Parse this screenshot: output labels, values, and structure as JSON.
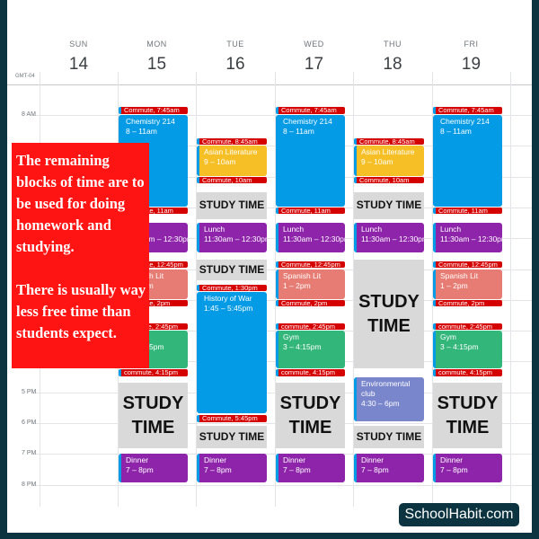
{
  "calendar": {
    "timezone": "GMT-04",
    "hour_labels": [
      {
        "hour": 8,
        "label": "8 AM"
      },
      {
        "hour": 17,
        "label": "5 PM"
      },
      {
        "hour": 18,
        "label": "6 PM"
      },
      {
        "hour": 19,
        "label": "7 PM"
      },
      {
        "hour": 20,
        "label": "8 PM"
      }
    ],
    "days": [
      {
        "name": "SUN",
        "date": "14",
        "events": []
      },
      {
        "name": "MON",
        "date": "15",
        "events": [
          {
            "title": "Commute, 7:45am",
            "start": 7.75,
            "end": 8,
            "type": "commute"
          },
          {
            "title": "Chemistry 214",
            "time": "8 – 11am",
            "start": 8,
            "end": 11,
            "color": "#039be5"
          },
          {
            "title": "Commute, 11am",
            "start": 11,
            "end": 11.25,
            "type": "commute"
          },
          {
            "title": "Lunch",
            "time": "11:30am – 12:30pm",
            "start": 11.5,
            "end": 12.5,
            "color": "#8e24aa"
          },
          {
            "title": "Commute, 12:45pm",
            "start": 12.75,
            "end": 13,
            "type": "commute"
          },
          {
            "title": "Spanish Lit",
            "time": "1 – 2pm",
            "start": 13,
            "end": 14,
            "color": "#e67c73"
          },
          {
            "title": "Commute, 2pm",
            "start": 14,
            "end": 14.25,
            "type": "commute"
          },
          {
            "title": "commute, 2:45pm",
            "start": 14.75,
            "end": 15,
            "type": "commute"
          },
          {
            "title": "Gym",
            "time": "3 – 4:15pm",
            "start": 15,
            "end": 16.25,
            "color": "#33b679"
          },
          {
            "title": "commute, 4:15pm",
            "start": 16.25,
            "end": 16.5,
            "type": "commute"
          },
          {
            "title": "STUDY TIME",
            "start": 16.7,
            "end": 18.85,
            "type": "study"
          },
          {
            "title": "Dinner",
            "time": "7 – 8pm",
            "start": 19,
            "end": 19.95,
            "color": "#8e24aa"
          }
        ]
      },
      {
        "name": "TUE",
        "date": "16",
        "events": [
          {
            "title": "Commute, 8:45am",
            "start": 8.75,
            "end": 9,
            "type": "commute"
          },
          {
            "title": "Asian Literature",
            "time": "9 – 10am",
            "start": 9,
            "end": 10,
            "color": "#f6bf26"
          },
          {
            "title": "Commute, 10am",
            "start": 10,
            "end": 10.25,
            "type": "commute"
          },
          {
            "title": "STUDY TIME",
            "start": 10.5,
            "end": 11.4,
            "type": "study"
          },
          {
            "title": "Lunch",
            "time": "11:30am – 12:30pm",
            "start": 11.5,
            "end": 12.5,
            "color": "#8e24aa"
          },
          {
            "title": "STUDY TIME",
            "start": 12.7,
            "end": 13.4,
            "type": "study"
          },
          {
            "title": "Commute, 1:30pm",
            "start": 13.5,
            "end": 13.75,
            "type": "commute"
          },
          {
            "title": "History of War",
            "time": "1:45 – 5:45pm",
            "start": 13.75,
            "end": 17.7,
            "color": "#039be5"
          },
          {
            "title": "Commute, 5:45pm",
            "start": 17.75,
            "end": 18,
            "type": "commute"
          },
          {
            "title": "STUDY TIME",
            "start": 18.1,
            "end": 18.85,
            "type": "study"
          },
          {
            "title": "Dinner",
            "time": "7 – 8pm",
            "start": 19,
            "end": 19.95,
            "color": "#8e24aa"
          }
        ]
      },
      {
        "name": "WED",
        "date": "17",
        "events": [
          {
            "title": "Commute, 7:45am",
            "start": 7.75,
            "end": 8,
            "type": "commute"
          },
          {
            "title": "Chemistry 214",
            "time": "8 – 11am",
            "start": 8,
            "end": 11,
            "color": "#039be5"
          },
          {
            "title": "Commute, 11am",
            "start": 11,
            "end": 11.25,
            "type": "commute"
          },
          {
            "title": "Lunch",
            "time": "11:30am – 12:30pm",
            "start": 11.5,
            "end": 12.5,
            "color": "#8e24aa"
          },
          {
            "title": "Commute, 12:45pm",
            "start": 12.75,
            "end": 13,
            "type": "commute"
          },
          {
            "title": "Spanish Lit",
            "time": "1 – 2pm",
            "start": 13,
            "end": 14,
            "color": "#e67c73"
          },
          {
            "title": "Commute, 2pm",
            "start": 14,
            "end": 14.25,
            "type": "commute"
          },
          {
            "title": "commute, 2:45pm",
            "start": 14.75,
            "end": 15,
            "type": "commute"
          },
          {
            "title": "Gym",
            "time": "3 – 4:15pm",
            "start": 15,
            "end": 16.25,
            "color": "#33b679"
          },
          {
            "title": "commute, 4:15pm",
            "start": 16.25,
            "end": 16.5,
            "type": "commute"
          },
          {
            "title": "STUDY TIME",
            "start": 16.7,
            "end": 18.85,
            "type": "study"
          },
          {
            "title": "Dinner",
            "time": "7 – 8pm",
            "start": 19,
            "end": 19.95,
            "color": "#8e24aa"
          }
        ]
      },
      {
        "name": "THU",
        "date": "18",
        "events": [
          {
            "title": "Commute, 8:45am",
            "start": 8.75,
            "end": 9,
            "type": "commute"
          },
          {
            "title": "Asian Literature",
            "time": "9 – 10am",
            "start": 9,
            "end": 10,
            "color": "#f6bf26"
          },
          {
            "title": "Commute, 10am",
            "start": 10,
            "end": 10.25,
            "type": "commute"
          },
          {
            "title": "STUDY TIME",
            "start": 10.5,
            "end": 11.4,
            "type": "study"
          },
          {
            "title": "Lunch",
            "time": "11:30am – 12:30pm",
            "start": 11.5,
            "end": 12.5,
            "color": "#8e24aa"
          },
          {
            "title": "STUDY TIME",
            "start": 12.7,
            "end": 16.25,
            "type": "study"
          },
          {
            "title": "Environmental club",
            "time": "4:30 – 6pm",
            "start": 16.5,
            "end": 17.97,
            "color": "#7986cb"
          },
          {
            "title": "STUDY TIME",
            "start": 18.1,
            "end": 18.85,
            "type": "study"
          },
          {
            "title": "Dinner",
            "time": "7 – 8pm",
            "start": 19,
            "end": 19.95,
            "color": "#8e24aa"
          }
        ]
      },
      {
        "name": "FRI",
        "date": "19",
        "events": [
          {
            "title": "Commute, 7:45am",
            "start": 7.75,
            "end": 8,
            "type": "commute"
          },
          {
            "title": "Chemistry 214",
            "time": "8 – 11am",
            "start": 8,
            "end": 11,
            "color": "#039be5"
          },
          {
            "title": "Commute, 11am",
            "start": 11,
            "end": 11.25,
            "type": "commute"
          },
          {
            "title": "Lunch",
            "time": "11:30am – 12:30pm",
            "start": 11.5,
            "end": 12.5,
            "color": "#8e24aa"
          },
          {
            "title": "Commute, 12:45pm",
            "start": 12.75,
            "end": 13,
            "type": "commute"
          },
          {
            "title": "Spanish Lit",
            "time": "1 – 2pm",
            "start": 13,
            "end": 14,
            "color": "#e67c73"
          },
          {
            "title": "Commute, 2pm",
            "start": 14,
            "end": 14.25,
            "type": "commute"
          },
          {
            "title": "commute, 2:45pm",
            "start": 14.75,
            "end": 15,
            "type": "commute"
          },
          {
            "title": "Gym",
            "time": "3 – 4:15pm",
            "start": 15,
            "end": 16.25,
            "color": "#33b679"
          },
          {
            "title": "commute, 4:15pm",
            "start": 16.25,
            "end": 16.5,
            "type": "commute"
          },
          {
            "title": "STUDY TIME",
            "start": 16.7,
            "end": 18.85,
            "type": "study"
          },
          {
            "title": "Dinner",
            "time": "7 – 8pm",
            "start": 19,
            "end": 19.95,
            "color": "#8e24aa"
          }
        ]
      }
    ]
  },
  "note": {
    "paragraph1": "The remaining blocks of time are to be used for doing homework and studying.",
    "paragraph2": "There is usually way less free time than students expect."
  },
  "logo": "SchoolHabit.com",
  "colors": {
    "frame": "#0b3340",
    "note_bg": "#ff1414",
    "commute": "#d50000",
    "study": "#d9d9d9"
  }
}
